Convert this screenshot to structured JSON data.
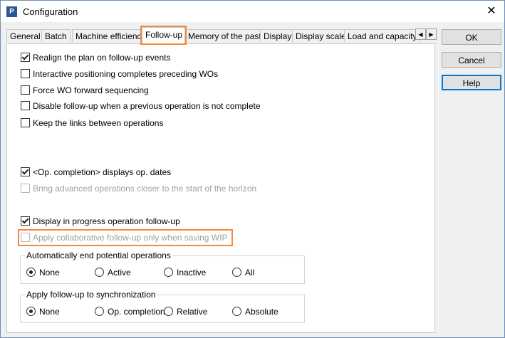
{
  "window": {
    "title": "Configuration",
    "icon_letter": "P"
  },
  "tabs": [
    {
      "label": "General"
    },
    {
      "label": "Batch"
    },
    {
      "label": "Machine efficiency"
    },
    {
      "label": "Follow-up"
    },
    {
      "label": "Memory of the past"
    },
    {
      "label": "Display"
    },
    {
      "label": "Display scale"
    },
    {
      "label": "Load and capacity"
    }
  ],
  "active_tab": "Follow-up",
  "options": [
    {
      "label": "Realign the plan on follow-up events",
      "checked": true,
      "enabled": true
    },
    {
      "label": "Interactive positioning completes preceding WOs",
      "checked": false,
      "enabled": true
    },
    {
      "label": "Force WO forward sequencing",
      "checked": false,
      "enabled": true
    },
    {
      "label": "Disable follow-up when a previous operation is not complete",
      "checked": false,
      "enabled": true
    },
    {
      "label": "Keep the links between operations",
      "checked": false,
      "enabled": true
    },
    {
      "label": "<Op. completion> displays op. dates",
      "checked": true,
      "enabled": true
    },
    {
      "label": "Bring advanced operations closer to the start of the horizon",
      "checked": false,
      "enabled": false
    },
    {
      "label": "Display in progress operation follow-up",
      "checked": true,
      "enabled": true
    },
    {
      "label": "Apply collaborative follow-up only when saving WIP",
      "checked": false,
      "enabled": false
    }
  ],
  "groups": {
    "auto_end": {
      "title": "Automatically end potential operations",
      "options": [
        "None",
        "Active",
        "Inactive",
        "All"
      ],
      "selected": "None"
    },
    "sync": {
      "title": "Apply follow-up to synchronization",
      "options": [
        "None",
        "Op. completion",
        "Relative",
        "Absolute"
      ],
      "selected": "None"
    }
  },
  "buttons": {
    "ok": "OK",
    "cancel": "Cancel",
    "help": "Help"
  },
  "colors": {
    "highlight": "#f08a3c",
    "default_button_border": "#0078d7"
  }
}
